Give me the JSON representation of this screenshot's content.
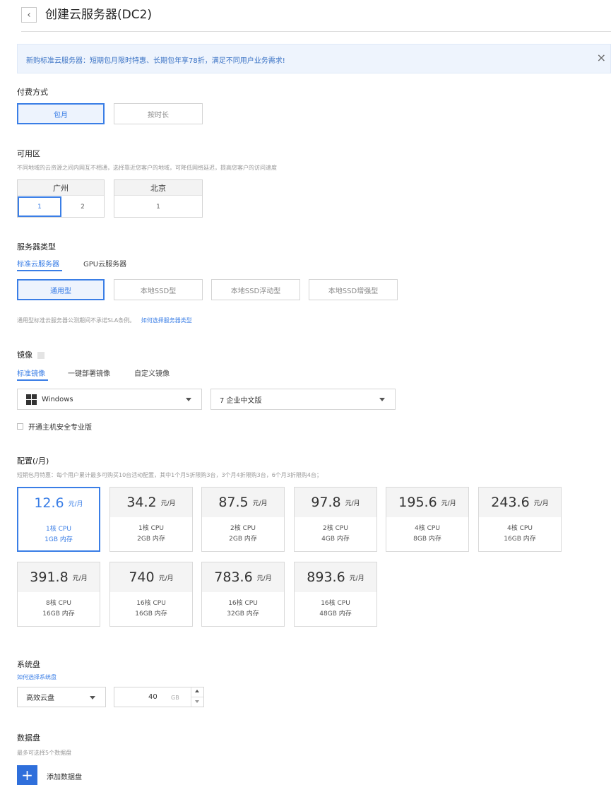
{
  "header": {
    "title": "创建云服务器(DC2)",
    "back_icon": "chevron-left-icon"
  },
  "notice": {
    "text": "新购标准云服务器：短期包月限时特惠、长期包年享78折，满足不同用户业务需求!",
    "close": "×"
  },
  "billing": {
    "label": "付费方式",
    "options": [
      "包月",
      "按时长"
    ],
    "selected": "包月"
  },
  "zone": {
    "label": "可用区",
    "hint": "不同地域的云资源之间内网互不相通，选择靠近您客户的地域，可降低网络延迟，提高您客户的访问速度",
    "regions": [
      {
        "name": "广州",
        "zones": [
          "1",
          "2"
        ]
      },
      {
        "name": "北京",
        "zones": [
          "1"
        ]
      }
    ],
    "selected": "广州-1"
  },
  "server_type": {
    "label": "服务器类型",
    "tabs": [
      "标准云服务器",
      "GPU云服务器"
    ],
    "active_tab": "标准云服务器",
    "options": [
      "通用型",
      "本地SSD型",
      "本地SSD浮动型",
      "本地SSD增强型"
    ],
    "selected": "通用型",
    "hint": "通用型标准云服务器公测期间不承诺SLA条例。",
    "hint_link": "如何选择服务器类型"
  },
  "image": {
    "label": "镜像",
    "tabs": [
      "标准镜像",
      "一键部署镜像",
      "自定义镜像"
    ],
    "active_tab": "标准镜像",
    "os": "Windows",
    "version": "7 企业中文版",
    "security_checkbox": "开通主机安全专业版"
  },
  "config": {
    "label": "配置(/月)",
    "hint": "短期包月特惠：每个用户累计最多可购买10台活动配置，其中1个月5折限购3台，3个月4折限购3台，6个月3折限购4台；",
    "unit": "元/月",
    "cards": [
      {
        "price": "12.6",
        "cpu": "1核 CPU",
        "mem": "1GB 内存"
      },
      {
        "price": "34.2",
        "cpu": "1核 CPU",
        "mem": "2GB 内存"
      },
      {
        "price": "87.5",
        "cpu": "2核 CPU",
        "mem": "2GB 内存"
      },
      {
        "price": "97.8",
        "cpu": "2核 CPU",
        "mem": "4GB 内存"
      },
      {
        "price": "195.6",
        "cpu": "4核 CPU",
        "mem": "8GB 内存"
      },
      {
        "price": "243.6",
        "cpu": "4核 CPU",
        "mem": "16GB 内存"
      },
      {
        "price": "391.8",
        "cpu": "8核 CPU",
        "mem": "16GB 内存"
      },
      {
        "price": "740",
        "cpu": "16核 CPU",
        "mem": "16GB 内存"
      },
      {
        "price": "783.6",
        "cpu": "16核 CPU",
        "mem": "32GB 内存"
      },
      {
        "price": "893.6",
        "cpu": "16核 CPU",
        "mem": "48GB 内存"
      }
    ],
    "selected_index": 0
  },
  "system_disk": {
    "label": "系统盘",
    "link": "如何选择系统盘",
    "type": "高效云盘",
    "size": "40",
    "unit": "GB"
  },
  "data_disk": {
    "label": "数据盘",
    "hint": "最多可选择5个数据盘",
    "add_label": "添加数据盘",
    "add_icon": "+"
  },
  "colors": {
    "accent": "#3a7ee6",
    "notice_bg": "#eef4fd",
    "add_button": "#2f6fdb"
  }
}
